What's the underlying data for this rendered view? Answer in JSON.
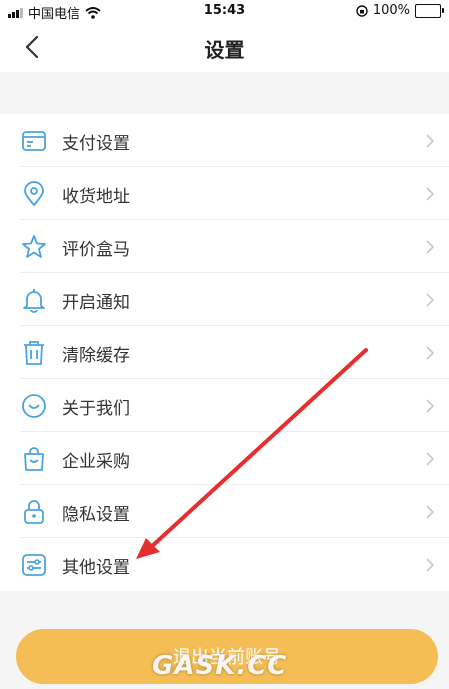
{
  "status": {
    "carrier": "中国电信",
    "time": "15:43",
    "battery": "100%"
  },
  "nav": {
    "title": "设置"
  },
  "items": [
    {
      "label": "支付设置",
      "icon": "card-icon"
    },
    {
      "label": "收货地址",
      "icon": "location-icon"
    },
    {
      "label": "评价盒马",
      "icon": "star-icon"
    },
    {
      "label": "开启通知",
      "icon": "bell-icon"
    },
    {
      "label": "清除缓存",
      "icon": "trash-icon"
    },
    {
      "label": "关于我们",
      "icon": "smile-icon"
    },
    {
      "label": "企业采购",
      "icon": "bag-icon"
    },
    {
      "label": "隐私设置",
      "icon": "lock-icon"
    },
    {
      "label": "其他设置",
      "icon": "sliders-icon"
    }
  ],
  "logout": {
    "label": "退出当前账号"
  },
  "watermark": {
    "text": "GASK.CC"
  },
  "colors": {
    "icon": "#4aa3df",
    "button": "#f4bd55",
    "arrow": "#e62e2e"
  }
}
